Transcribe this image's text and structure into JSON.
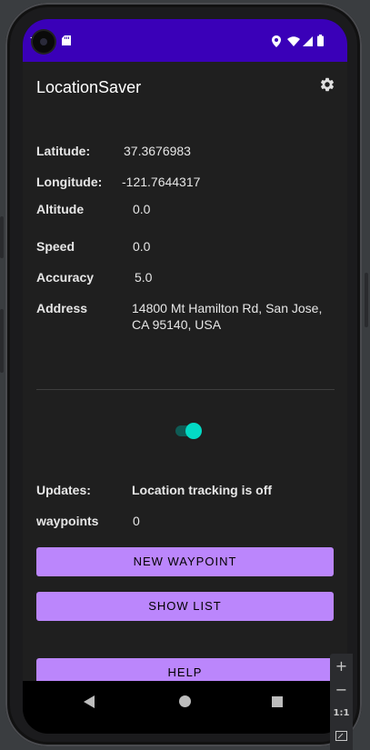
{
  "status_bar": {
    "time": "7",
    "icons": [
      "sd-card-icon",
      "location-pin-icon",
      "wifi-icon",
      "signal-icon",
      "battery-icon"
    ]
  },
  "app_bar": {
    "title": "LocationSaver",
    "settings_icon": "gear-icon"
  },
  "location": {
    "latitude_label": "Latitude:",
    "latitude_value": "37.3676983",
    "longitude_label": "Longitude:",
    "longitude_value": "-121.7644317",
    "altitude_label": "Altitude",
    "altitude_value": "0.0",
    "speed_label": "Speed",
    "speed_value": "0.0",
    "accuracy_label": "Accuracy",
    "accuracy_value": "5.0",
    "address_label": "Address",
    "address_line1": "14800 Mt Hamilton Rd, San Jose,",
    "address_line2": "CA 95140, USA"
  },
  "tracking": {
    "switch_on": true,
    "updates_label": "Updates:",
    "updates_value": "Location tracking is off",
    "waypoints_label": "waypoints",
    "waypoints_value": "0"
  },
  "buttons": {
    "new_waypoint": "NEW WAYPOINT",
    "show_list": "SHOW LIST",
    "help": "HELP"
  },
  "nav_bar": {
    "items": [
      "back-icon",
      "home-icon",
      "recents-icon"
    ]
  },
  "zoom_controls": {
    "zoom_in": "+",
    "zoom_out": "−",
    "one_to_one": "1:1"
  },
  "colors": {
    "status_bar": "#3a00b8",
    "app_surface": "#1f1f1f",
    "button": "#bb86fc",
    "switch_thumb": "#03dac5"
  }
}
